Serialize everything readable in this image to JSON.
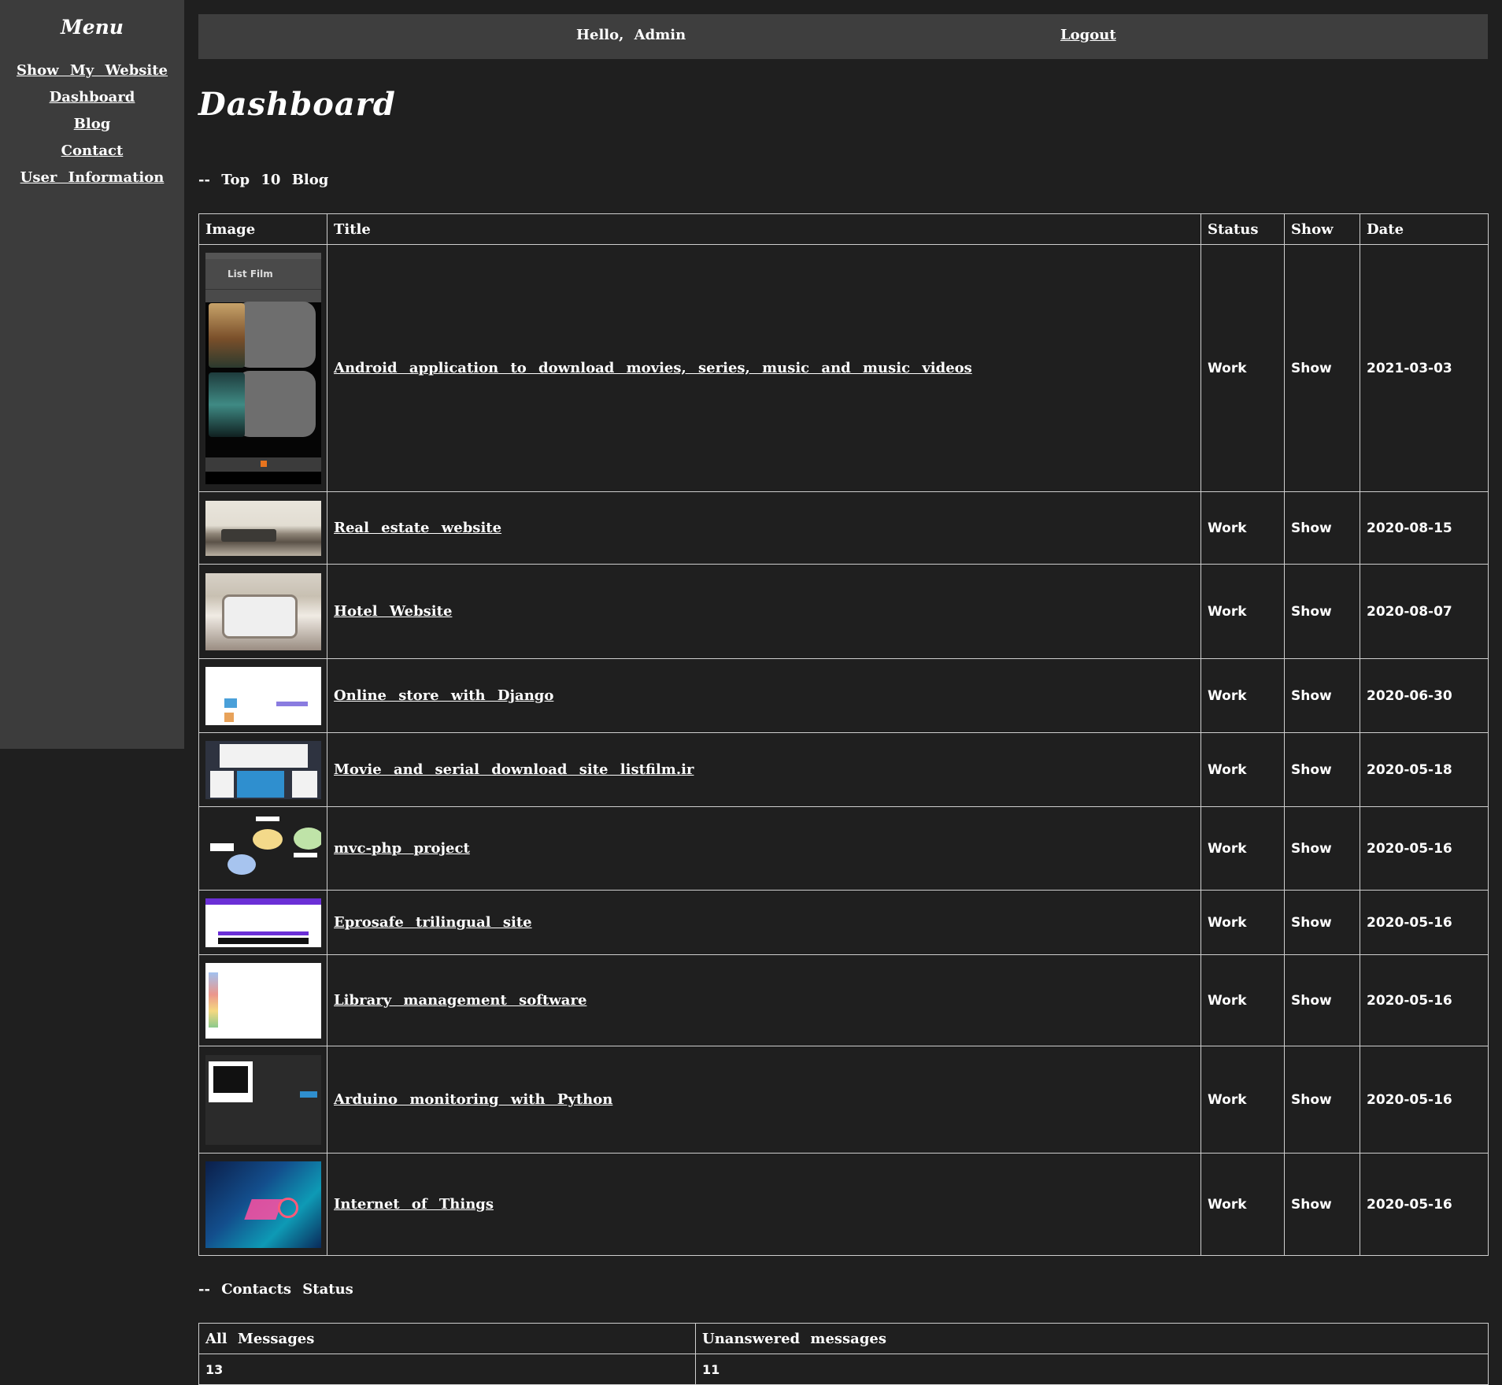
{
  "sidebar": {
    "title": "Menu",
    "items": [
      {
        "label": "Show My Website"
      },
      {
        "label": "Dashboard"
      },
      {
        "label": "Blog"
      },
      {
        "label": "Contact"
      },
      {
        "label": "User Information"
      }
    ]
  },
  "header": {
    "greeting": "Hello, Admin",
    "logout_label": "Logout"
  },
  "page": {
    "title": "Dashboard"
  },
  "blog_section": {
    "heading": "-- Top 10 Blog",
    "columns": [
      "Image",
      "Title",
      "Status",
      "Show",
      "Date"
    ],
    "rows": [
      {
        "title": "Android application to download movies, series, music and music videos",
        "status": "Work",
        "show": "Show",
        "date": "2021-03-03",
        "thumb_text": "List Film"
      },
      {
        "title": "Real estate website",
        "status": "Work",
        "show": "Show",
        "date": "2020-08-15"
      },
      {
        "title": "Hotel Website",
        "status": "Work",
        "show": "Show",
        "date": "2020-08-07"
      },
      {
        "title": "Online store with Django",
        "status": "Work",
        "show": "Show",
        "date": "2020-06-30"
      },
      {
        "title": "Movie and serial download site listfilm.ir",
        "status": "Work",
        "show": "Show",
        "date": "2020-05-18"
      },
      {
        "title": "mvc-php project",
        "status": "Work",
        "show": "Show",
        "date": "2020-05-16"
      },
      {
        "title": "Eprosafe trilingual site",
        "status": "Work",
        "show": "Show",
        "date": "2020-05-16"
      },
      {
        "title": "Library management software",
        "status": "Work",
        "show": "Show",
        "date": "2020-05-16"
      },
      {
        "title": "Arduino monitoring with Python",
        "status": "Work",
        "show": "Show",
        "date": "2020-05-16"
      },
      {
        "title": "Internet of Things",
        "status": "Work",
        "show": "Show",
        "date": "2020-05-16"
      }
    ]
  },
  "contacts_section": {
    "heading": "-- Contacts Status",
    "columns": [
      "All Messages",
      "Unanswered messages"
    ],
    "values": [
      "13",
      "11"
    ]
  },
  "colors": {
    "background": "#1f1f1f",
    "sidebar": "#3c3c3c",
    "topbar": "#3e3e3e",
    "text": "#ffffff",
    "border": "#cfcfcf"
  }
}
